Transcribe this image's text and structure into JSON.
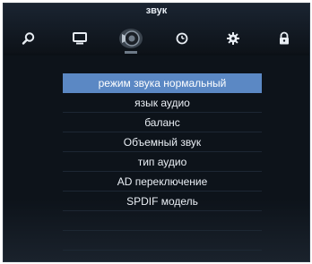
{
  "header": {
    "title": "звук",
    "active_tab": "sound",
    "tabs": [
      {
        "id": "search",
        "icon": "search-icon"
      },
      {
        "id": "picture",
        "icon": "monitor-icon"
      },
      {
        "id": "sound",
        "icon": "speaker-icon"
      },
      {
        "id": "time",
        "icon": "clock-icon"
      },
      {
        "id": "settings",
        "icon": "gear-icon"
      },
      {
        "id": "lock",
        "icon": "lock-icon"
      }
    ]
  },
  "menu": {
    "items": [
      {
        "label": "режим звука нормальный",
        "selected": true
      },
      {
        "label": "язык аудио",
        "selected": false
      },
      {
        "label": "баланс",
        "selected": false
      },
      {
        "label": "Объемный звук",
        "selected": false
      },
      {
        "label": "тип аудио",
        "selected": false
      },
      {
        "label": "AD переключение",
        "selected": false
      },
      {
        "label": "SPDIF модель",
        "selected": false
      },
      {
        "label": "",
        "selected": false
      },
      {
        "label": "",
        "selected": false
      }
    ]
  },
  "colors": {
    "background": "#0b1016",
    "selected_row": "#5b88c4",
    "text": "#e9eef4"
  }
}
